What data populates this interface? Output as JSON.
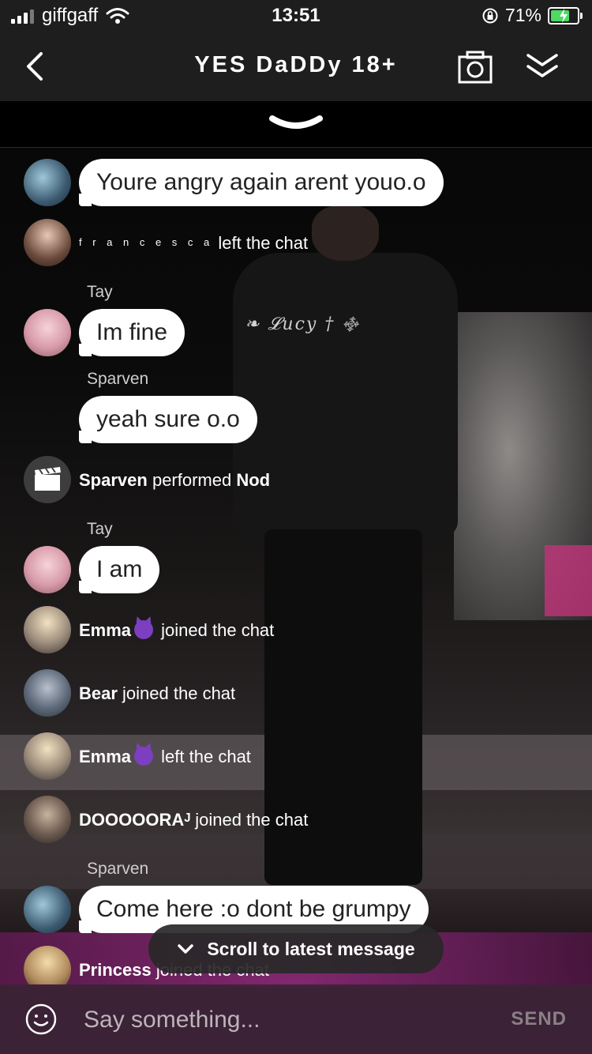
{
  "status_bar": {
    "carrier": "giffgaff",
    "time": "13:51",
    "battery_percent": "71%",
    "battery_level": 0.71
  },
  "header": {
    "title": "YES DaDDy 18+"
  },
  "scene": {
    "caption": "❧ 𝓛ucy † ࿇"
  },
  "chat": {
    "messages": {
      "m1": {
        "text": "Youre angry again arent youo.o"
      },
      "m2": {
        "user": "f r a n c e s c a",
        "action": "left the chat"
      },
      "m3": {
        "sender": "Tay",
        "text": "Im fine"
      },
      "m4": {
        "sender": "Sparven",
        "text": "yeah sure o.o"
      },
      "m5": {
        "user": "Sparven",
        "action": "performed",
        "target": "Nod"
      },
      "m6": {
        "sender": "Tay",
        "text": "I am"
      },
      "m7": {
        "user": "Emma",
        "action": "joined the chat"
      },
      "m8": {
        "user": "Bear",
        "action": "joined the chat"
      },
      "m9": {
        "user": "Emma",
        "action": "left the chat"
      },
      "m10": {
        "user": "DOOOOORAᴶ",
        "action": "joined the chat"
      },
      "m11": {
        "sender": "Sparven",
        "text": "Come here :o dont be grumpy"
      },
      "m12": {
        "user": "Princess",
        "action": "joined the chat"
      }
    }
  },
  "scroll_pill": {
    "label": "Scroll to latest message"
  },
  "input": {
    "placeholder": "Say something...",
    "send_label": "SEND"
  },
  "colors": {
    "bubble": "#ffffff",
    "header": "#1e1e1e",
    "battery_fill": "#4cd964",
    "input_bar": "#3c2337"
  }
}
